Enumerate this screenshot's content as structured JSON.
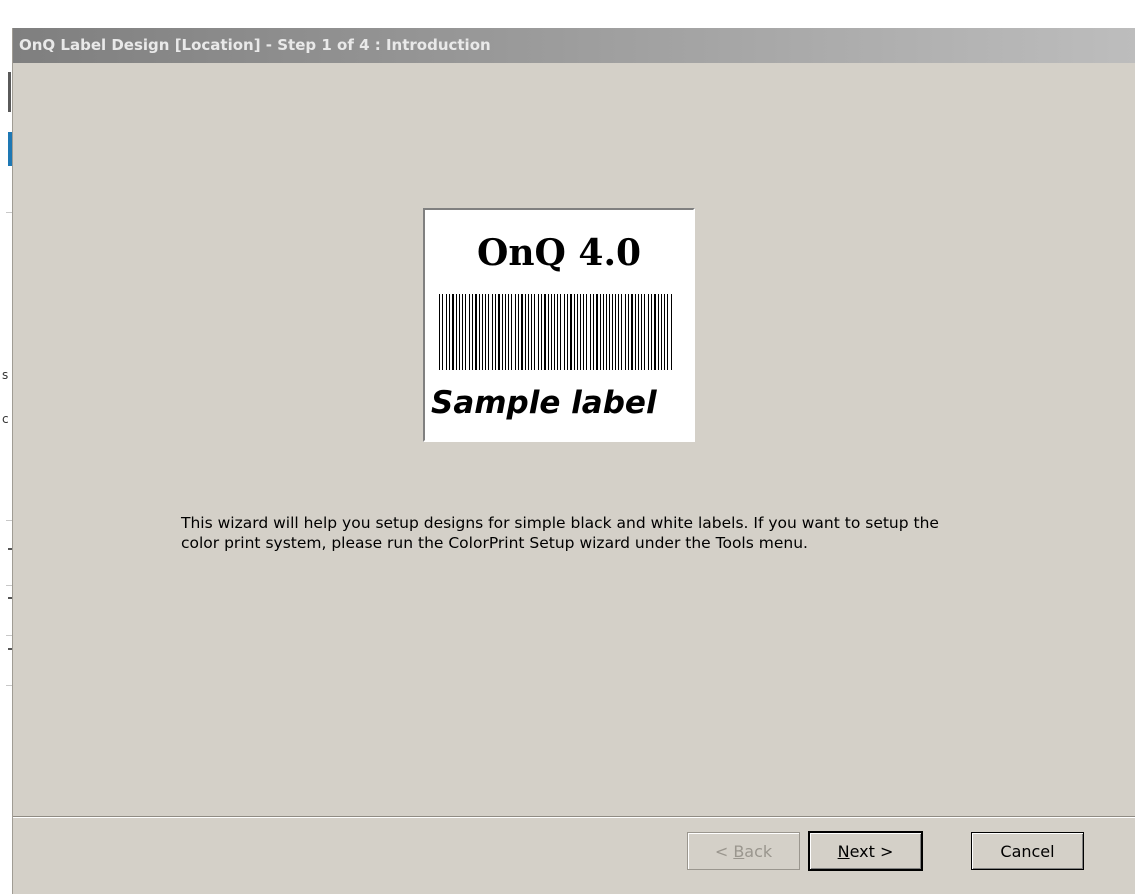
{
  "window": {
    "title": "OnQ Label Design [Location] - Step 1 of 4 : Introduction"
  },
  "background": {
    "edge_chars": [
      "s",
      "c"
    ]
  },
  "sample_label": {
    "heading": "OnQ 4.0",
    "footer": "Sample label",
    "barcode_icon": "barcode-icon"
  },
  "intro_text": "This wizard will help you setup designs for simple black and white labels. If you want to setup the color print system, please run the ColorPrint Setup wizard under the Tools menu.",
  "buttons": {
    "back": {
      "pre": "< ",
      "accel": "B",
      "post": "ack",
      "enabled": false
    },
    "next": {
      "accel": "N",
      "post": "ext >",
      "enabled": true
    },
    "cancel": {
      "label": "Cancel",
      "enabled": true
    }
  },
  "colors": {
    "dialog_bg": "#d4d0c8",
    "title_text": "#e9e9e9",
    "disabled_text": "#9a968e"
  }
}
